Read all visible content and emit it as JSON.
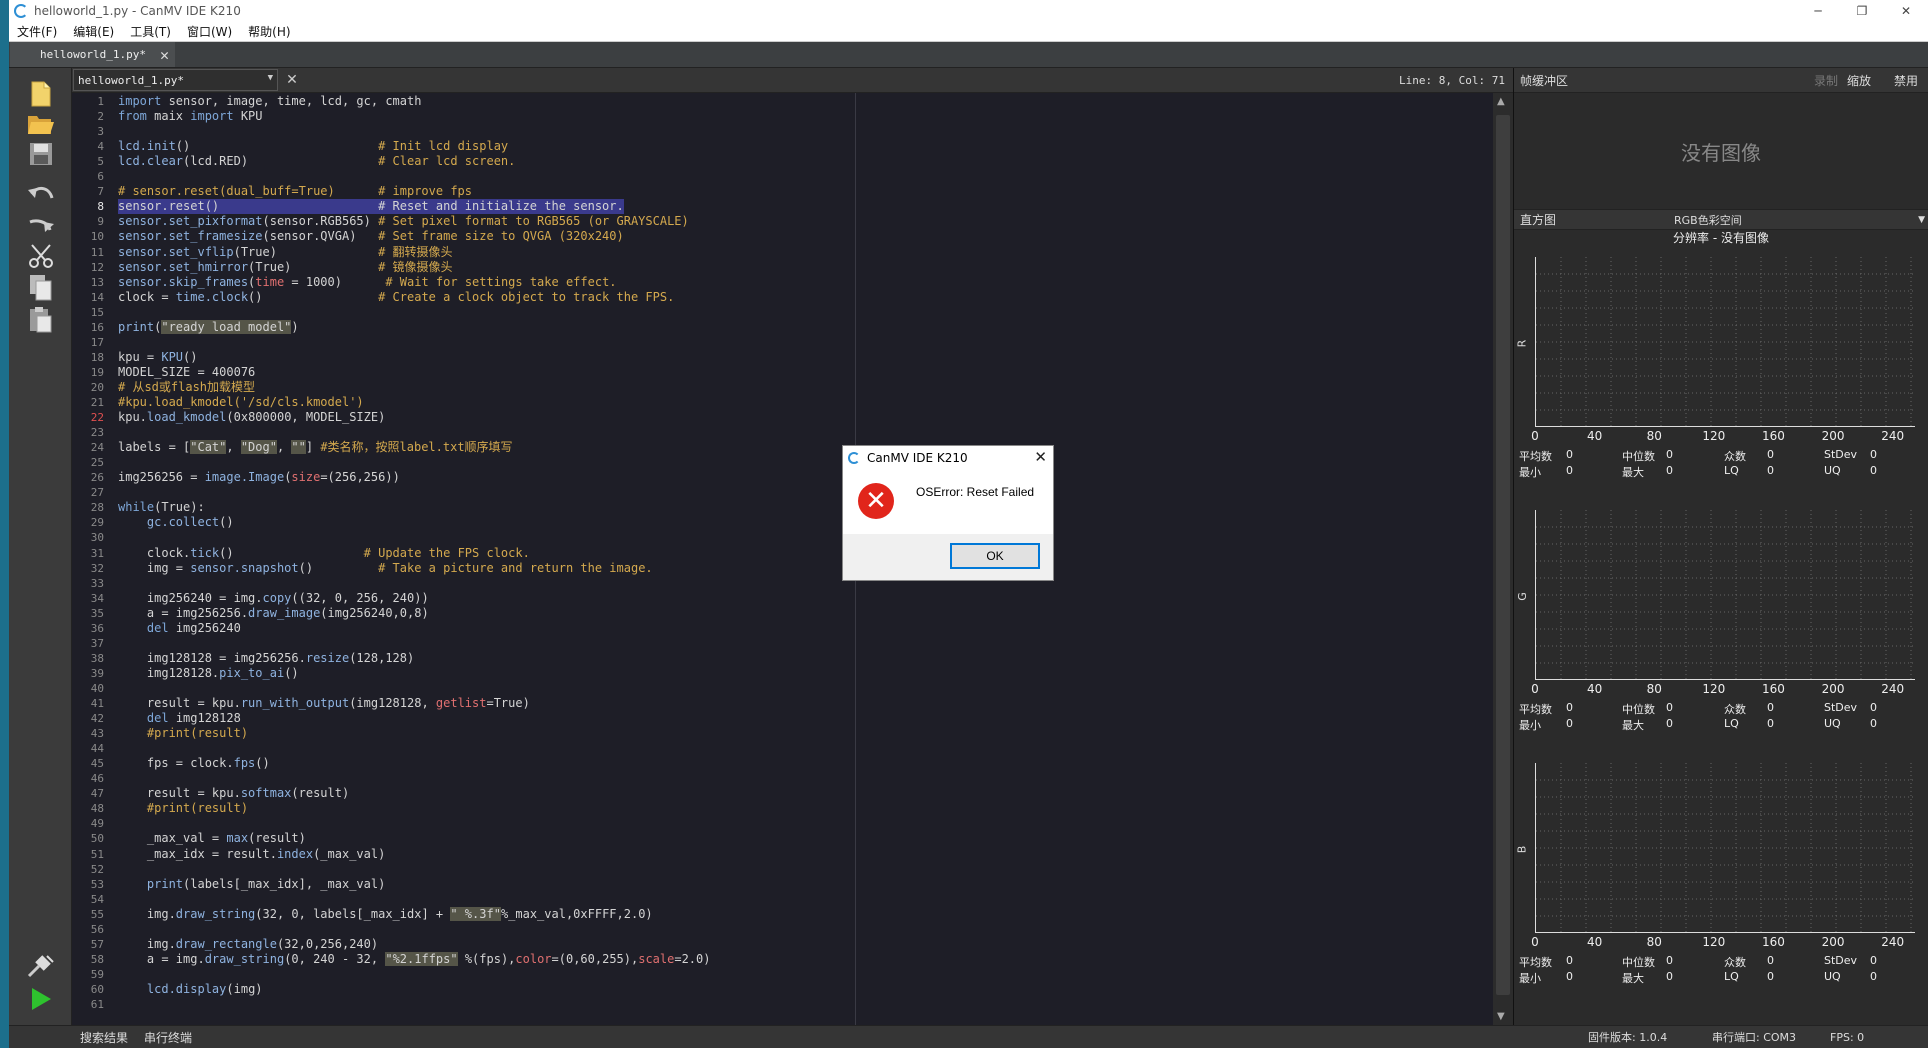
{
  "window": {
    "title": "helloworld_1.py - CanMV IDE K210",
    "controls": {
      "minimize": "─",
      "maximize": "❐",
      "close": "✕"
    }
  },
  "menu": [
    "文件(F)",
    "编辑(E)",
    "工具(T)",
    "窗口(W)",
    "帮助(H)"
  ],
  "tab": {
    "label": "helloworld_1.py*",
    "close": "✕"
  },
  "editor_header": {
    "document": "helloworld_1.py*",
    "close": "✕",
    "cursor": "Line: 8, Col: 71"
  },
  "editor": {
    "current_line": 8,
    "error_line": 22,
    "line_count": 61,
    "lines": [
      [
        [
          "c-kw",
          "import "
        ],
        [
          "c-txt",
          "sensor, image, time, lcd, gc, cmath"
        ]
      ],
      [
        [
          "c-kw",
          "from "
        ],
        [
          "c-txt",
          "maix "
        ],
        [
          "c-kw",
          "import "
        ],
        [
          "c-txt",
          "KPU"
        ]
      ],
      [],
      [
        [
          "c-fn",
          "lcd.init"
        ],
        [
          "c-txt",
          "()                          "
        ],
        [
          "c-cmt",
          "# Init lcd display"
        ]
      ],
      [
        [
          "c-fn",
          "lcd.clear"
        ],
        [
          "c-txt",
          "(lcd.RED)                  "
        ],
        [
          "c-cmt",
          "# Clear lcd screen."
        ]
      ],
      [],
      [
        [
          "c-cmt",
          "# sensor.reset(dual_buff=True)      # improve fps"
        ]
      ],
      [
        [
          "c-txt",
          "sensor.reset()                      # Reset and initialize the sensor."
        ]
      ],
      [
        [
          "c-fn",
          "sensor.set_pixformat"
        ],
        [
          "c-txt",
          "(sensor.RGB565) "
        ],
        [
          "c-cmt",
          "# Set pixel format to RGB565 (or GRAYSCALE)"
        ]
      ],
      [
        [
          "c-fn",
          "sensor.set_framesize"
        ],
        [
          "c-txt",
          "(sensor.QVGA)   "
        ],
        [
          "c-cmt",
          "# Set frame size to QVGA (320x240)"
        ]
      ],
      [
        [
          "c-fn",
          "sensor.set_vflip"
        ],
        [
          "c-txt",
          "(True)              "
        ],
        [
          "c-cmt",
          "# 翻转摄像头"
        ]
      ],
      [
        [
          "c-fn",
          "sensor.set_hmirror"
        ],
        [
          "c-txt",
          "(True)            "
        ],
        [
          "c-cmt",
          "# 镜像摄像头"
        ]
      ],
      [
        [
          "c-fn",
          "sensor.skip_frames"
        ],
        [
          "c-txt",
          "("
        ],
        [
          "c-red",
          "time"
        ],
        [
          "c-txt",
          " = 1000)      "
        ],
        [
          "c-cmt",
          "# Wait for settings take effect."
        ]
      ],
      [
        [
          "c-txt",
          "clock = "
        ],
        [
          "c-fn",
          "time.clock"
        ],
        [
          "c-txt",
          "()                "
        ],
        [
          "c-cmt",
          "# Create a clock object to track the FPS."
        ]
      ],
      [],
      [
        [
          "c-fn",
          "print"
        ],
        [
          "c-txt",
          "("
        ],
        [
          "c-str",
          "\"ready load model\""
        ],
        [
          "c-txt",
          ")"
        ]
      ],
      [],
      [
        [
          "c-txt",
          "kpu = "
        ],
        [
          "c-fn",
          "KPU"
        ],
        [
          "c-txt",
          "()"
        ]
      ],
      [
        [
          "c-txt",
          "MODEL_SIZE = 400076"
        ]
      ],
      [
        [
          "c-cmt",
          "# 从sd或flash加载模型"
        ]
      ],
      [
        [
          "c-cmt",
          "#kpu.load_kmodel('/sd/cls.kmodel')"
        ]
      ],
      [
        [
          "c-txt",
          "kpu."
        ],
        [
          "c-fn",
          "load_kmodel"
        ],
        [
          "c-txt",
          "(0x800000, MODEL_SIZE)"
        ]
      ],
      [],
      [
        [
          "c-txt",
          "labels = ["
        ],
        [
          "c-str",
          "\"Cat\""
        ],
        [
          "c-txt",
          ", "
        ],
        [
          "c-str",
          "\"Dog\""
        ],
        [
          "c-txt",
          ", "
        ],
        [
          "c-str",
          "\"\""
        ],
        [
          "c-txt",
          "] "
        ],
        [
          "c-cmt",
          "#类名称，按照label.txt顺序填写"
        ]
      ],
      [],
      [
        [
          "c-txt",
          "img256256 = "
        ],
        [
          "c-fn",
          "image.Image"
        ],
        [
          "c-txt",
          "("
        ],
        [
          "c-red",
          "size"
        ],
        [
          "c-txt",
          "=(256,256))"
        ]
      ],
      [],
      [
        [
          "c-kw",
          "while"
        ],
        [
          "c-txt",
          "(True):"
        ]
      ],
      [
        [
          "c-txt",
          "    "
        ],
        [
          "c-fn",
          "gc.collect"
        ],
        [
          "c-txt",
          "()"
        ]
      ],
      [],
      [
        [
          "c-txt",
          "    clock."
        ],
        [
          "c-fn",
          "tick"
        ],
        [
          "c-txt",
          "()                  "
        ],
        [
          "c-cmt",
          "# Update the FPS clock."
        ]
      ],
      [
        [
          "c-txt",
          "    img = "
        ],
        [
          "c-fn",
          "sensor.snapshot"
        ],
        [
          "c-txt",
          "()         "
        ],
        [
          "c-cmt",
          "# Take a picture and return the image."
        ]
      ],
      [],
      [
        [
          "c-txt",
          "    img256240 = img."
        ],
        [
          "c-fn",
          "copy"
        ],
        [
          "c-txt",
          "((32, 0, 256, 240))"
        ]
      ],
      [
        [
          "c-txt",
          "    a = img256256."
        ],
        [
          "c-fn",
          "draw_image"
        ],
        [
          "c-txt",
          "(img256240,0,8)"
        ]
      ],
      [
        [
          "c-txt",
          "    "
        ],
        [
          "c-kw",
          "del "
        ],
        [
          "c-txt",
          "img256240"
        ]
      ],
      [],
      [
        [
          "c-txt",
          "    img128128 = img256256."
        ],
        [
          "c-fn",
          "resize"
        ],
        [
          "c-txt",
          "(128,128)"
        ]
      ],
      [
        [
          "c-txt",
          "    img128128."
        ],
        [
          "c-fn",
          "pix_to_ai"
        ],
        [
          "c-txt",
          "()"
        ]
      ],
      [],
      [
        [
          "c-txt",
          "    result = kpu."
        ],
        [
          "c-fn",
          "run_with_output"
        ],
        [
          "c-txt",
          "(img128128, "
        ],
        [
          "c-red",
          "getlist"
        ],
        [
          "c-txt",
          "=True)"
        ]
      ],
      [
        [
          "c-txt",
          "    "
        ],
        [
          "c-kw",
          "del "
        ],
        [
          "c-txt",
          "img128128"
        ]
      ],
      [
        [
          "c-txt",
          "    "
        ],
        [
          "c-cmt",
          "#print(result)"
        ]
      ],
      [],
      [
        [
          "c-txt",
          "    fps = clock."
        ],
        [
          "c-fn",
          "fps"
        ],
        [
          "c-txt",
          "()"
        ]
      ],
      [],
      [
        [
          "c-txt",
          "    result = kpu."
        ],
        [
          "c-fn",
          "softmax"
        ],
        [
          "c-txt",
          "(result)"
        ]
      ],
      [
        [
          "c-txt",
          "    "
        ],
        [
          "c-cmt",
          "#print(result)"
        ]
      ],
      [],
      [
        [
          "c-txt",
          "    _max_val = "
        ],
        [
          "c-fn",
          "max"
        ],
        [
          "c-txt",
          "(result)"
        ]
      ],
      [
        [
          "c-txt",
          "    _max_idx = result."
        ],
        [
          "c-fn",
          "index"
        ],
        [
          "c-txt",
          "(_max_val)"
        ]
      ],
      [],
      [
        [
          "c-txt",
          "    "
        ],
        [
          "c-fn",
          "print"
        ],
        [
          "c-txt",
          "(labels[_max_idx], _max_val)"
        ]
      ],
      [],
      [
        [
          "c-txt",
          "    img."
        ],
        [
          "c-fn",
          "draw_string"
        ],
        [
          "c-txt",
          "(32, 0, labels[_max_idx] + "
        ],
        [
          "c-str",
          "\" %.3f\""
        ],
        [
          "c-txt",
          "%_max_val,0xFFFF,2.0)"
        ]
      ],
      [],
      [
        [
          "c-txt",
          "    img."
        ],
        [
          "c-fn",
          "draw_rectangle"
        ],
        [
          "c-txt",
          "(32,0,256,240)"
        ]
      ],
      [
        [
          "c-txt",
          "    a = img."
        ],
        [
          "c-fn",
          "draw_string"
        ],
        [
          "c-txt",
          "(0, 240 - 32, "
        ],
        [
          "c-str",
          "\"%2.1ffps\""
        ],
        [
          "c-txt",
          " %(fps),"
        ],
        [
          "c-red",
          "color"
        ],
        [
          "c-txt",
          "=(0,60,255),"
        ],
        [
          "c-red",
          "scale"
        ],
        [
          "c-txt",
          "=2.0)"
        ]
      ],
      [],
      [
        [
          "c-txt",
          "    "
        ],
        [
          "c-fn",
          "lcd.display"
        ],
        [
          "c-txt",
          "(img)"
        ]
      ],
      []
    ]
  },
  "toolbar": {
    "tools": [
      "new-file-icon",
      "open-file-icon",
      "save-icon",
      "undo-icon",
      "redo-icon",
      "cut-icon",
      "copy-icon",
      "paste-icon",
      "connect-icon",
      "run-icon"
    ]
  },
  "framebuffer": {
    "title": "帧缓冲区",
    "record": "录制",
    "zoom": "缩放",
    "disable": "禁用",
    "no_image": "没有图像"
  },
  "histogram": {
    "title": "直方图",
    "colorspace": "RGB色彩空间",
    "resolution": "分辨率 - 没有图像",
    "x_ticks": [
      "0",
      "40",
      "80",
      "120",
      "160",
      "200",
      "240"
    ],
    "channels": [
      {
        "name": "R",
        "mean_label": "平均数",
        "mean": "0",
        "median_label": "中位数",
        "median": "0",
        "mode_label": "众数",
        "mode": "0",
        "stdev_label": "StDev",
        "stdev": "0",
        "min_label": "最小",
        "min": "0",
        "max_label": "最大",
        "max": "0",
        "lq_label": "LQ",
        "lq": "0",
        "uq_label": "UQ",
        "uq": "0"
      },
      {
        "name": "G",
        "mean_label": "平均数",
        "mean": "0",
        "median_label": "中位数",
        "median": "0",
        "mode_label": "众数",
        "mode": "0",
        "stdev_label": "StDev",
        "stdev": "0",
        "min_label": "最小",
        "min": "0",
        "max_label": "最大",
        "max": "0",
        "lq_label": "LQ",
        "lq": "0",
        "uq_label": "UQ",
        "uq": "0"
      },
      {
        "name": "B",
        "mean_label": "平均数",
        "mean": "0",
        "median_label": "中位数",
        "median": "0",
        "mode_label": "众数",
        "mode": "0",
        "stdev_label": "StDev",
        "stdev": "0",
        "min_label": "最小",
        "min": "0",
        "max_label": "最大",
        "max": "0",
        "lq_label": "LQ",
        "lq": "0",
        "uq_label": "UQ",
        "uq": "0"
      }
    ]
  },
  "statusbar": {
    "search_results": "搜索结果",
    "serial_terminal": "串行终端",
    "firmware": "固件版本: 1.0.4",
    "serial_port": "串行端口: COM3",
    "fps": "FPS: 0"
  },
  "dialog": {
    "title": "CanMV IDE K210",
    "close": "✕",
    "error_glyph": "✕",
    "message": "OSError: Reset Failed",
    "ok": "OK"
  }
}
